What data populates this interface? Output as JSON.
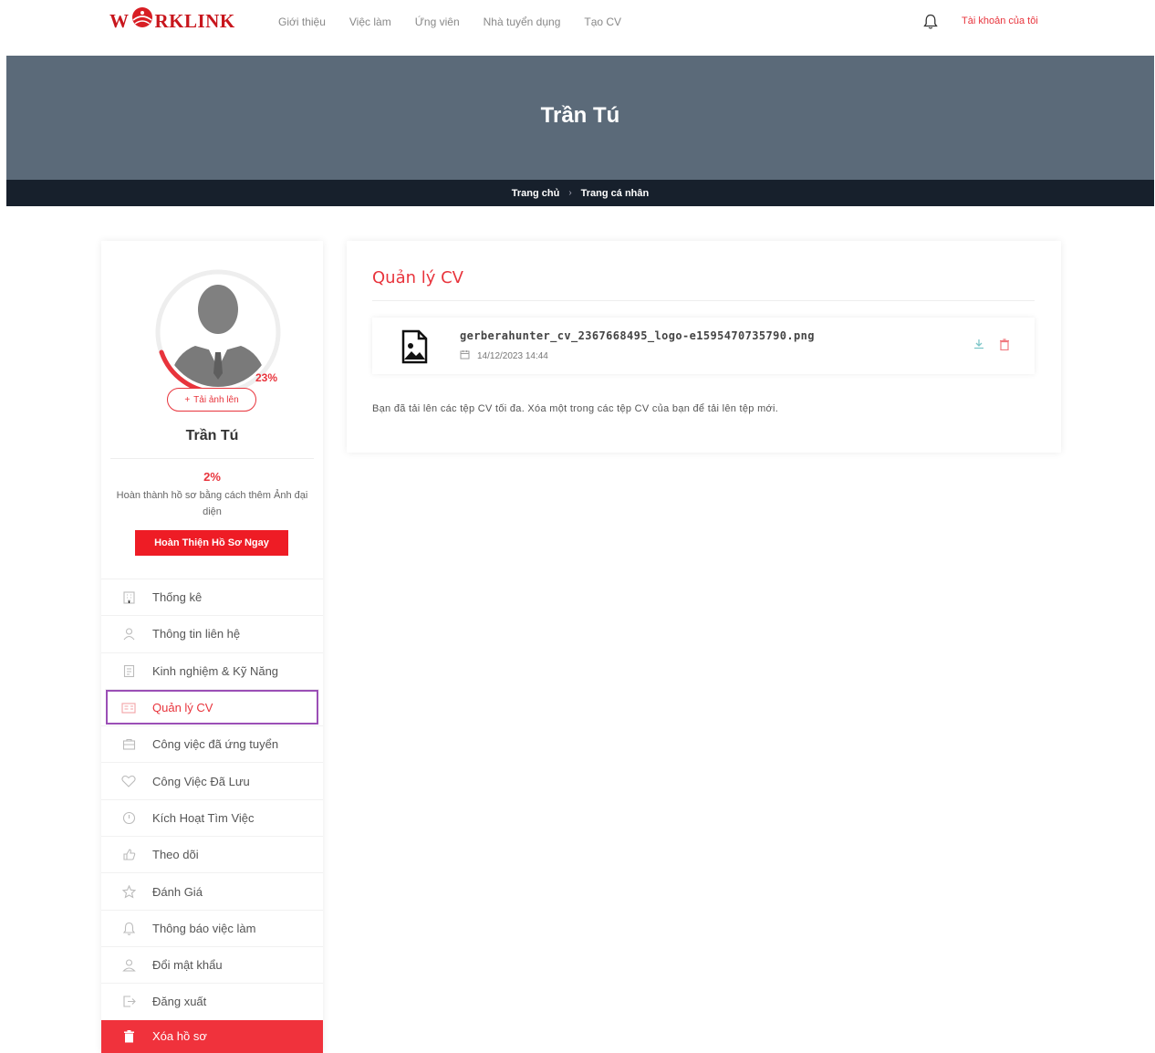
{
  "brand": {
    "logo_left": "W",
    "logo_right": "RKLINK",
    "accent_color": "#e8343c",
    "banner_color": "#5b6a79",
    "breadcrumb_bg": "#17202c"
  },
  "nav": {
    "links": [
      "Giới thiệu",
      "Việc làm",
      "Ứng viên",
      "Nhà tuyển dụng",
      "Tạo CV"
    ],
    "notification_icon": "bell-icon",
    "account_label": "Tài khoản của tôi"
  },
  "banner": {
    "title": "Trần Tú"
  },
  "breadcrumb": {
    "home": "Trang chủ",
    "separator": "›",
    "current": "Trang cá nhân"
  },
  "profile": {
    "ring_percent_label": "23%",
    "ring_percent": 23,
    "upload_label": "Tải ảnh lên",
    "name": "Trần Tú",
    "completion_percent": "2%",
    "completion_text": "Hoàn thành hồ sơ bằng cách thêm Ảnh đại diện",
    "completion_button": "Hoàn Thiện Hồ Sơ Ngay"
  },
  "menu": {
    "items": [
      {
        "label": "Thống kê",
        "icon": "building-icon"
      },
      {
        "label": "Thông tin liên hệ",
        "icon": "user-icon"
      },
      {
        "label": "Kinh nghiệm & Kỹ Năng",
        "icon": "document-icon"
      },
      {
        "label": "Quản lý CV",
        "icon": "cv-card-icon"
      },
      {
        "label": "Công việc đã ứng tuyển",
        "icon": "briefcase-icon"
      },
      {
        "label": "Công Việc Đã Lưu",
        "icon": "heart-icon"
      },
      {
        "label": "Kích Hoạt Tìm Việc",
        "icon": "power-icon"
      },
      {
        "label": "Theo dõi",
        "icon": "thumbs-up-icon"
      },
      {
        "label": "Đánh Giá",
        "icon": "star-icon"
      },
      {
        "label": "Thông báo việc làm",
        "icon": "bell-icon"
      },
      {
        "label": "Đổi mật khẩu",
        "icon": "user-lock-icon"
      },
      {
        "label": "Đăng xuất",
        "icon": "logout-icon"
      },
      {
        "label": "Xóa hồ sơ",
        "icon": "trash-icon"
      }
    ],
    "active_index": 3
  },
  "main": {
    "title": "Quản lý CV",
    "cv_files": [
      {
        "filename": "gerberahunter_cv_2367668495_logo-e1595470735790.png",
        "date": "14/12/2023 14:44",
        "file_icon": "image-file-icon",
        "actions": [
          "download-icon",
          "trash-icon"
        ]
      }
    ],
    "note": "Bạn đã tải lên các tệp CV tối đa. Xóa một trong các tệp CV của bạn để tải lên tệp mới."
  }
}
